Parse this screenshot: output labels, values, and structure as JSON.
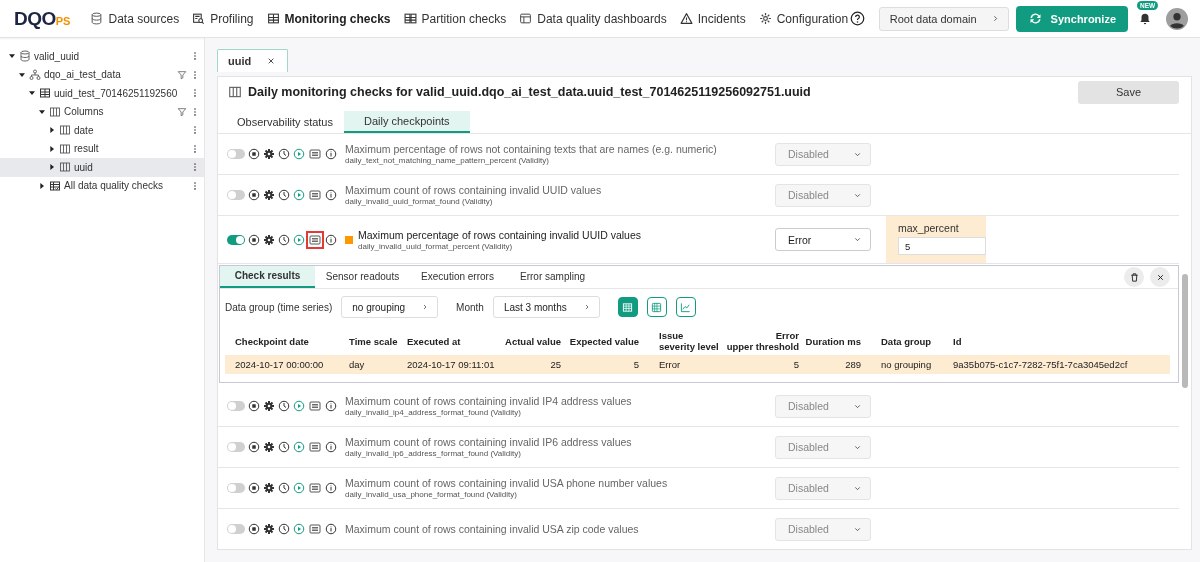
{
  "logo": {
    "main": "DQO",
    "suffix": "PS"
  },
  "nav": [
    {
      "label": "Data sources",
      "selected": false
    },
    {
      "label": "Profiling",
      "selected": false
    },
    {
      "label": "Monitoring checks",
      "selected": true
    },
    {
      "label": "Partition checks",
      "selected": false
    },
    {
      "label": "Data quality dashboards",
      "selected": false
    },
    {
      "label": "Incidents",
      "selected": false
    },
    {
      "label": "Configuration",
      "selected": false
    }
  ],
  "domain_button": "Root data domain",
  "sync_button": "Synchronize",
  "notification_badge": "NEW",
  "tree": [
    {
      "label": "valid_uuid",
      "kind": "connection",
      "expanded": true,
      "selected": false,
      "filterable": false,
      "children": [
        {
          "label": "dqo_ai_test_data",
          "kind": "schema",
          "expanded": true,
          "selected": false,
          "filterable": true,
          "children": [
            {
              "label": "uuid_test_70146251192560",
              "kind": "table",
              "expanded": true,
              "selected": false,
              "filterable": false,
              "children": [
                {
                  "label": "Columns",
                  "kind": "folder",
                  "expanded": true,
                  "selected": false,
                  "filterable": true,
                  "children": [
                    {
                      "label": "date",
                      "kind": "column",
                      "expanded": false,
                      "selected": false,
                      "filterable": false
                    },
                    {
                      "label": "result",
                      "kind": "column",
                      "expanded": false,
                      "selected": false,
                      "filterable": false
                    },
                    {
                      "label": "uuid",
                      "kind": "column",
                      "expanded": false,
                      "selected": true,
                      "filterable": false
                    }
                  ]
                },
                {
                  "label": "All data quality checks",
                  "kind": "checks",
                  "expanded": false,
                  "selected": false,
                  "filterable": false
                }
              ]
            }
          ]
        }
      ]
    }
  ],
  "editor_tab": {
    "label": "uuid"
  },
  "editor": {
    "title": "Daily monitoring checks for valid_uuid.dqo_ai_test_data.uuid_test_7014625119256092751.uuid",
    "save": "Save",
    "tabs": [
      {
        "label": "Observability status",
        "selected": false
      },
      {
        "label": "Daily checkpoints",
        "selected": true
      }
    ],
    "rows": [
      {
        "kind": "check",
        "enabled": false,
        "results_open": false,
        "title": "Maximum percentage of rows not containing texts that are names (e.g. numeric)",
        "subtitle": "daily_text_not_matching_name_pattern_percent (Validity)",
        "severity": "Disabled"
      },
      {
        "kind": "check",
        "enabled": false,
        "results_open": false,
        "title": "Maximum count of rows containing invalid UUID values",
        "subtitle": "daily_invalid_uuid_format_found (Validity)",
        "severity": "Disabled"
      },
      {
        "kind": "check",
        "enabled": true,
        "results_open": true,
        "color": "#ff9800",
        "title": "Maximum percentage of rows containing invalid UUID values",
        "subtitle": "daily_invalid_uuid_format_percent (Validity)",
        "severity": "Error",
        "rule": {
          "label": "max_percent",
          "value": "5"
        }
      },
      {
        "kind": "results",
        "tabs": [
          {
            "label": "Check results",
            "selected": true
          },
          {
            "label": "Sensor readouts",
            "selected": false
          },
          {
            "label": "Execution errors",
            "selected": false
          },
          {
            "label": "Error sampling",
            "selected": false
          }
        ],
        "data_group_label": "Data group (time series)",
        "data_group": "no grouping",
        "period_label": "Month",
        "period": "Last 3 months",
        "views": [
          {
            "selected": true
          },
          {
            "selected": false
          },
          {
            "selected": false
          }
        ],
        "columns": [
          "Checkpoint date",
          "Time scale",
          "Executed at",
          "Actual value",
          "Expected value",
          "Issue\nseverity level",
          "Error\nupper threshold",
          "Duration ms",
          "Data group",
          "Id"
        ],
        "table_rows": [
          [
            "2024-10-17 00:00:00",
            "day",
            "2024-10-17 09:11:01",
            "25",
            "5",
            "Error",
            "5",
            "289",
            "no grouping",
            "9a35b075-c1c7-7282-75f1-7ca3045ed2cf"
          ]
        ]
      },
      {
        "kind": "check",
        "enabled": false,
        "results_open": false,
        "title": "Maximum count of rows containing invalid IP4 address values",
        "subtitle": "daily_invalid_ip4_address_format_found (Validity)",
        "severity": "Disabled"
      },
      {
        "kind": "check",
        "enabled": false,
        "results_open": false,
        "title": "Maximum count of rows containing invalid IP6 address values",
        "subtitle": "daily_invalid_ip6_address_format_found (Validity)",
        "severity": "Disabled"
      },
      {
        "kind": "check",
        "enabled": false,
        "results_open": false,
        "title": "Maximum count of rows containing invalid USA phone number values",
        "subtitle": "daily_invalid_usa_phone_format_found (Validity)",
        "severity": "Disabled"
      },
      {
        "kind": "check",
        "enabled": false,
        "results_open": false,
        "title": "Maximum count of rows containing invalid USA zip code values",
        "severity": "Disabled"
      }
    ]
  }
}
